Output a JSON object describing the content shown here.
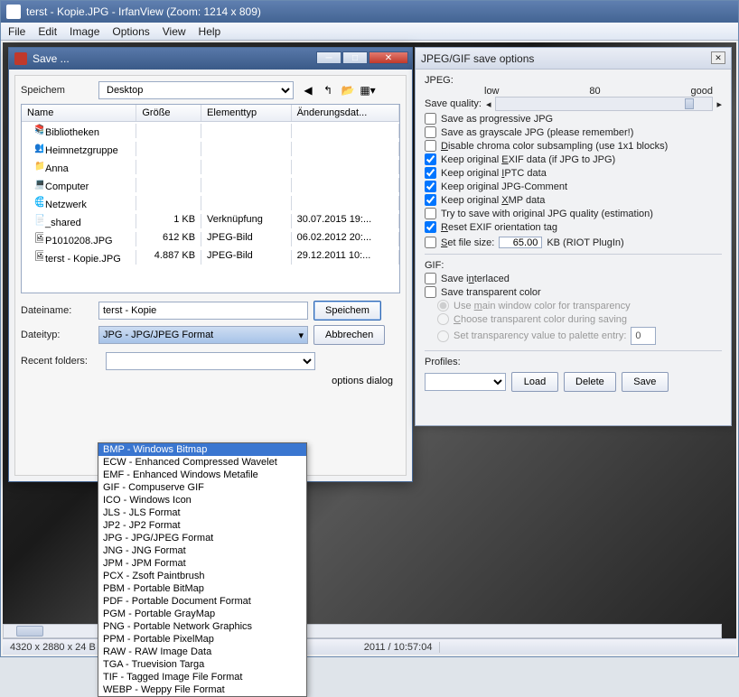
{
  "main": {
    "title": "terst - Kopie.JPG - IrfanView (Zoom: 1214 x 809)",
    "menu": [
      "File",
      "Edit",
      "Image",
      "Options",
      "View",
      "Help"
    ],
    "status_left": "4320 x 2880 x 24 B",
    "status_mid": "2011 / 10:57:04"
  },
  "save": {
    "title": "Save ...",
    "location_label": "Speichem",
    "location_value": "Desktop",
    "cols": {
      "name": "Name",
      "size": "Größe",
      "type": "Elementtyp",
      "date": "Änderungsdat..."
    },
    "items": [
      {
        "icon": "📚",
        "name": "Bibliotheken",
        "size": "",
        "type": "",
        "date": ""
      },
      {
        "icon": "👥",
        "name": "Heimnetzgruppe",
        "size": "",
        "type": "",
        "date": ""
      },
      {
        "icon": "📁",
        "name": "Anna",
        "size": "",
        "type": "",
        "date": ""
      },
      {
        "icon": "💻",
        "name": "Computer",
        "size": "",
        "type": "",
        "date": ""
      },
      {
        "icon": "🌐",
        "name": "Netzwerk",
        "size": "",
        "type": "",
        "date": ""
      },
      {
        "icon": "📄",
        "name": "_shared",
        "size": "1 KB",
        "type": "Verknüpfung",
        "date": "30.07.2015 19:..."
      },
      {
        "icon": "🖼",
        "name": "P1010208.JPG",
        "size": "612 KB",
        "type": "JPEG-Bild",
        "date": "06.02.2012 20:..."
      },
      {
        "icon": "🖼",
        "name": "terst - Kopie.JPG",
        "size": "4.887 KB",
        "type": "JPEG-Bild",
        "date": "29.12.2011 10:..."
      }
    ],
    "filename_label": "Dateiname:",
    "filename_value": "terst - Kopie",
    "filetype_label": "Dateityp:",
    "filetype_value": "JPG - JPG/JPEG Format",
    "recent_label": "Recent folders:",
    "show_options": "options dialog",
    "save_btn": "Speichem",
    "cancel_btn": "Abbrechen",
    "formats": [
      "BMP - Windows Bitmap",
      "ECW - Enhanced Compressed Wavelet",
      "EMF - Enhanced Windows Metafile",
      "GIF - Compuserve GIF",
      "ICO - Windows Icon",
      "JLS - JLS Format",
      "JP2 - JP2 Format",
      "JPG - JPG/JPEG Format",
      "JNG - JNG Format",
      "JPM - JPM Format",
      "PCX - Zsoft Paintbrush",
      "PBM - Portable BitMap",
      "PDF - Portable Document Format",
      "PGM - Portable GrayMap",
      "PNG - Portable Network Graphics",
      "PPM - Portable PixelMap",
      "RAW - RAW Image Data",
      "TGA - Truevision Targa",
      "TIF - Tagged Image File Format",
      "WEBP - Weppy File Format"
    ]
  },
  "opts": {
    "title": "JPEG/GIF save options",
    "jpeg_label": "JPEG:",
    "low": "low",
    "good": "good",
    "quality_value": "80",
    "save_quality": "Save quality:",
    "progressive": "Save as progressive JPG",
    "grayscale": "Save as grayscale JPG (please remember!)",
    "chroma": "Disable chroma color subsampling (use 1x1 blocks)",
    "exif": "Keep original EXIF data (if JPG to JPG)",
    "iptc": "Keep original IPTC data",
    "comment": "Keep original JPG-Comment",
    "xmp": "Keep original XMP data",
    "estimate": "Try to save with original JPG quality (estimation)",
    "reset": "Reset EXIF orientation tag",
    "setsize": "Set file size:",
    "setsize_value": "65.00",
    "setsize_unit": "KB (RIOT PlugIn)",
    "gif_label": "GIF:",
    "interlaced": "Save interlaced",
    "transparent": "Save transparent color",
    "r1": "Use main window color for transparency",
    "r2": "Choose transparent color during saving",
    "r3": "Set transparency value to palette entry:",
    "r3_value": "0",
    "profiles": "Profiles:",
    "load": "Load",
    "delete": "Delete",
    "save": "Save"
  }
}
